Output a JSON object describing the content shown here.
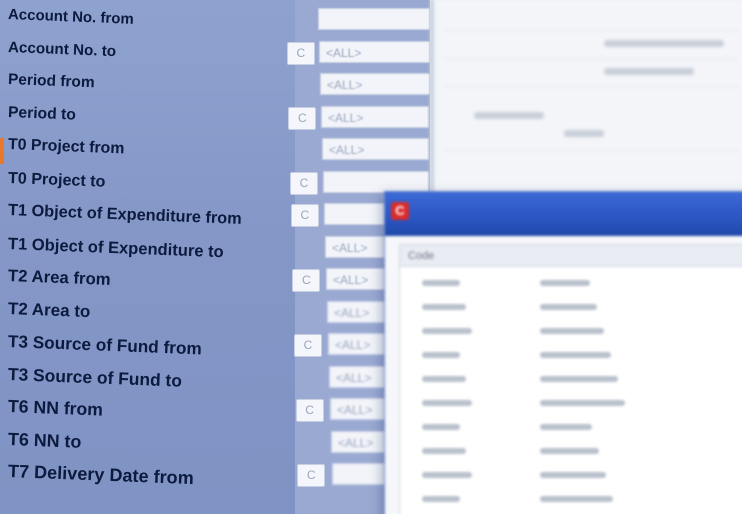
{
  "params": [
    {
      "label": "Account No. from",
      "field": "",
      "has_button": false
    },
    {
      "label": "Account No. to",
      "field": "<ALL>",
      "has_button": true
    },
    {
      "label": "Period from",
      "field": "<ALL>",
      "has_button": false
    },
    {
      "label": "Period to",
      "field": "<ALL>",
      "has_button": true
    },
    {
      "label": "T0 Project from",
      "field": "<ALL>",
      "has_button": false
    },
    {
      "label": "T0 Project to",
      "field": "",
      "has_button": true
    },
    {
      "label": "T1 Object of Expenditure from",
      "field": "",
      "has_button": true
    },
    {
      "label": "T1 Object of Expenditure to",
      "field": "<ALL>",
      "has_button": false
    },
    {
      "label": "T2 Area from",
      "field": "<ALL>",
      "has_button": true
    },
    {
      "label": "T2 Area to",
      "field": "<ALL>",
      "has_button": false
    },
    {
      "label": "T3 Source of Fund from",
      "field": "<ALL>",
      "has_button": true
    },
    {
      "label": "T3 Source of Fund to",
      "field": "<ALL>",
      "has_button": false
    },
    {
      "label": "T6 NN from",
      "field": "<ALL>",
      "has_button": true
    },
    {
      "label": "T6 NN to",
      "field": "<ALL>",
      "has_button": false
    },
    {
      "label": "T7 Delivery Date from",
      "field": "",
      "has_button": true
    }
  ],
  "button_glyph": "C",
  "popup": {
    "icon_letter": "C",
    "title": "",
    "columns": [
      "Code",
      ""
    ]
  },
  "colors": {
    "panel": "#8497c7",
    "titlebar": "#2a55c2",
    "accent": "#e8792a"
  }
}
